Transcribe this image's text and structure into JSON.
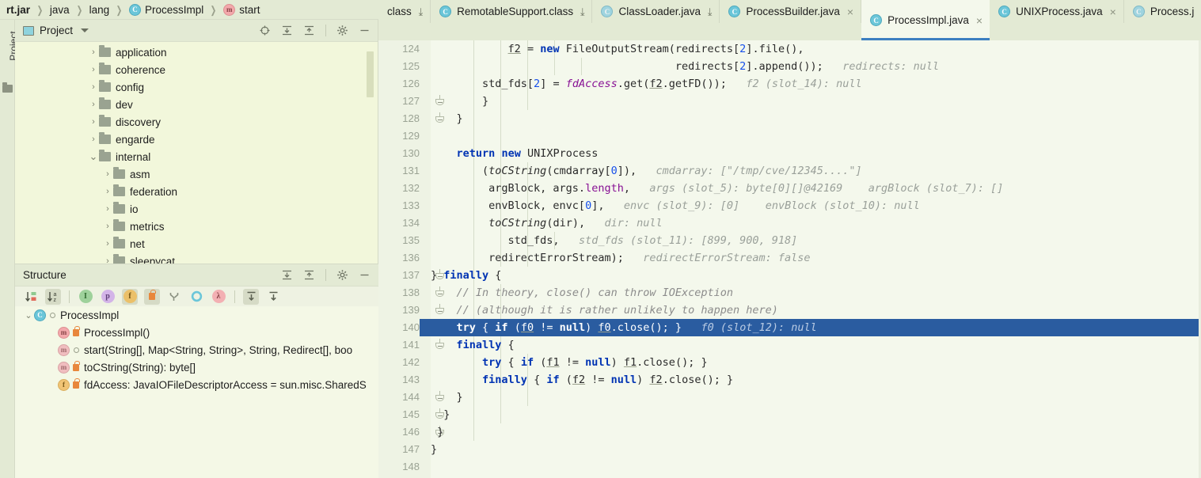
{
  "breadcrumb": {
    "name": "breadcrumb",
    "items": [
      {
        "label": "rt.jar",
        "icon": "",
        "bold": true
      },
      {
        "label": "java",
        "icon": "",
        "bold": false
      },
      {
        "label": "lang",
        "icon": "",
        "bold": false
      },
      {
        "label": "ProcessImpl",
        "icon": "class-icon",
        "bold": false
      },
      {
        "label": "start",
        "icon": "method-icon",
        "bold": false
      }
    ],
    "separator": "❯"
  },
  "tool_stripe": {
    "label": "Project",
    "icon": "project-folder-icon"
  },
  "project_panel": {
    "title": "Project",
    "dropdown_icon": "chevron-down-icon",
    "header_icons": [
      "locate-icon",
      "expand-all-icon",
      "collapse-all-icon",
      "gear-icon",
      "hide-icon"
    ],
    "tree": [
      {
        "label": "application",
        "depth": 1,
        "arrow": "›",
        "expanded": false
      },
      {
        "label": "coherence",
        "depth": 1,
        "arrow": "›",
        "expanded": false
      },
      {
        "label": "config",
        "depth": 1,
        "arrow": "›",
        "expanded": false
      },
      {
        "label": "dev",
        "depth": 1,
        "arrow": "›",
        "expanded": false
      },
      {
        "label": "discovery",
        "depth": 1,
        "arrow": "›",
        "expanded": false
      },
      {
        "label": "engarde",
        "depth": 1,
        "arrow": "›",
        "expanded": false
      },
      {
        "label": "internal",
        "depth": 1,
        "arrow": "⌄",
        "expanded": true
      },
      {
        "label": "asm",
        "depth": 2,
        "arrow": "›",
        "expanded": false
      },
      {
        "label": "federation",
        "depth": 2,
        "arrow": "›",
        "expanded": false
      },
      {
        "label": "io",
        "depth": 2,
        "arrow": "›",
        "expanded": false
      },
      {
        "label": "metrics",
        "depth": 2,
        "arrow": "›",
        "expanded": false
      },
      {
        "label": "net",
        "depth": 2,
        "arrow": "›",
        "expanded": false
      },
      {
        "label": "sleepycat",
        "depth": 2,
        "arrow": "›",
        "expanded": false
      }
    ]
  },
  "structure_panel": {
    "title": "Structure",
    "header_icons": [
      "expand-all-icon",
      "collapse-all-icon",
      "gear-icon",
      "hide-icon"
    ],
    "toolbar_icons": [
      {
        "name": "sort-by-visibility-icon",
        "glyph": "↓",
        "pressed": false
      },
      {
        "name": "sort-alphabetically-icon",
        "glyph": "↓",
        "pressed": true
      },
      {
        "name": "show-inherited-icon",
        "glyph": "I",
        "color": "#8fc98f",
        "text": "#2f6b2f"
      },
      {
        "name": "show-properties-icon",
        "glyph": "p",
        "color": "#cdaee4",
        "text": "#5f3f78"
      },
      {
        "name": "show-fields-icon",
        "glyph": "f",
        "color": "#e8bc5e",
        "text": "#6e5012",
        "pressed": true
      },
      {
        "name": "show-non-public-icon",
        "glyph": "■",
        "color": "#e8873c",
        "text": "#e8873c",
        "pressed": true
      },
      {
        "name": "group-by-type-icon",
        "glyph": "Y",
        "color": "#9aa08c",
        "text": "#6a7060"
      },
      {
        "name": "show-anonymous-icon",
        "glyph": "O",
        "color": "#6bc6d9",
        "text": "#6bc6d9"
      },
      {
        "name": "show-lambdas-icon",
        "glyph": "λ",
        "color": "#f3a8ab",
        "text": "#8a4548"
      },
      {
        "name": "autoscroll-to-source-icon",
        "glyph": "↑",
        "pressed": true
      },
      {
        "name": "autoscroll-from-source-icon",
        "glyph": "↓",
        "pressed": false
      }
    ],
    "tree": [
      {
        "label": "ProcessImpl",
        "depth": 0,
        "arrow": "⌄",
        "icon": "class-icon",
        "badge": "ring"
      },
      {
        "label": "ProcessImpl()",
        "depth": 1,
        "arrow": "",
        "icon": "method-icon",
        "badge": "lock"
      },
      {
        "label": "start(String[], Map<String, String>, String, Redirect[], boo",
        "depth": 1,
        "arrow": "",
        "icon": "method-static-icon",
        "badge": "ring"
      },
      {
        "label": "toCString(String): byte[]",
        "depth": 1,
        "arrow": "",
        "icon": "method-static-icon",
        "badge": "lock"
      },
      {
        "label": "fdAccess: JavaIOFileDescriptorAccess = sun.misc.SharedS",
        "depth": 1,
        "arrow": "",
        "icon": "field-static-icon",
        "badge": "lock"
      }
    ]
  },
  "editor": {
    "tabs": [
      {
        "label": "class",
        "icon": "",
        "active": false,
        "close": "pin",
        "truncated_left": true
      },
      {
        "label": "RemotableSupport.class",
        "icon": "class-icon",
        "active": false,
        "close": "pin"
      },
      {
        "label": "ClassLoader.java",
        "icon": "class-dim-icon",
        "active": false,
        "close": "pin"
      },
      {
        "label": "ProcessBuilder.java",
        "icon": "class-icon",
        "active": false,
        "close": "x"
      },
      {
        "label": "ProcessImpl.java",
        "icon": "class-icon",
        "active": true,
        "close": "x"
      },
      {
        "label": "UNIXProcess.java",
        "icon": "class-icon",
        "active": false,
        "close": "x"
      },
      {
        "label": "Process.j",
        "icon": "class-dim-icon",
        "active": false,
        "close": ""
      }
    ],
    "first_line_number": 124,
    "selected_line": 140,
    "lines": [
      {
        "n": 124,
        "indent": 0,
        "fold": "",
        "html": "partial-top"
      },
      {
        "n": 125,
        "indent": 0,
        "fold": "",
        "html": "l125"
      },
      {
        "n": 126,
        "indent": 0,
        "fold": "",
        "html": "l126"
      },
      {
        "n": 127,
        "indent": 0,
        "fold": "minus",
        "html": "l127"
      },
      {
        "n": 128,
        "indent": 0,
        "fold": "minus",
        "html": "l128"
      },
      {
        "n": 129,
        "indent": 0,
        "fold": "",
        "html": ""
      },
      {
        "n": 130,
        "indent": 0,
        "fold": "",
        "html": "l130"
      },
      {
        "n": 131,
        "indent": 0,
        "fold": "",
        "html": "l131"
      },
      {
        "n": 132,
        "indent": 0,
        "fold": "",
        "html": "l132"
      },
      {
        "n": 133,
        "indent": 0,
        "fold": "",
        "html": "l133"
      },
      {
        "n": 134,
        "indent": 0,
        "fold": "",
        "html": "l134"
      },
      {
        "n": 135,
        "indent": 0,
        "fold": "",
        "html": "l135"
      },
      {
        "n": 136,
        "indent": 0,
        "fold": "",
        "html": "l136"
      },
      {
        "n": 137,
        "indent": 0,
        "fold": "minus",
        "html": "l137"
      },
      {
        "n": 138,
        "indent": 0,
        "fold": "minus",
        "html": "l138"
      },
      {
        "n": 139,
        "indent": 0,
        "fold": "minus",
        "html": "l139"
      },
      {
        "n": 140,
        "indent": 0,
        "fold": "",
        "html": "l140"
      },
      {
        "n": 141,
        "indent": 0,
        "fold": "minus",
        "html": "l141"
      },
      {
        "n": 142,
        "indent": 0,
        "fold": "",
        "html": "l142"
      },
      {
        "n": 143,
        "indent": 0,
        "fold": "",
        "html": "l143"
      },
      {
        "n": 144,
        "indent": 0,
        "fold": "minus",
        "html": "l144"
      },
      {
        "n": 145,
        "indent": 0,
        "fold": "minus",
        "html": "l145"
      },
      {
        "n": 146,
        "indent": 0,
        "fold": "minus",
        "html": "l146"
      },
      {
        "n": 147,
        "indent": 0,
        "fold": "",
        "html": "l147"
      },
      {
        "n": 148,
        "indent": 0,
        "fold": "",
        "html": ""
      }
    ],
    "code_text": {
      "l124": "            f2 = new FileOutputStream(redirects[2].file(),",
      "l125": "                                      redirects[2].append());   redirects: null",
      "l126": "        std_fds[2] = fdAccess.get(f2.getFD());   f2 (slot_14): null",
      "l127": "        }",
      "l128": "    }",
      "l130": "    return new UNIXProcess",
      "l131": "        (toCString(cmdarray[0]),   cmdarray: [\"/tmp/cve/12345....\"]",
      "l132": "         argBlock, args.length,   args (slot_5): byte[0][]@42169    argBlock (slot_7): []",
      "l133": "         envBlock, envc[0],   envc (slot_9): [0]    envBlock (slot_10): null",
      "l134": "         toCString(dir),   dir: null",
      "l135": "            std_fds,   std_fds (slot_11): [899, 900, 918]",
      "l136": "         redirectErrorStream);   redirectErrorStream: false",
      "l137": "} finally {",
      "l138": "    // In theory, close() can throw IOException",
      "l139": "    // (although it is rather unlikely to happen here)",
      "l140": "    try { if (f0 != null) f0.close(); }   f0 (slot_12): null",
      "l141": "    finally {",
      "l142": "        try { if (f1 != null) f1.close(); }",
      "l143": "        finally { if (f2 != null) f2.close(); }",
      "l144": "    }",
      "l145": "  }",
      "l146": " }",
      "l147": "}"
    },
    "inline_hints": {
      "redirects": "redirects: null",
      "f2_slot14": "f2 (slot_14): null",
      "cmdarray": "cmdarray: [\"/tmp/cve/12345....\"]",
      "args_slot5": "args (slot_5): byte[0][]@42169",
      "argBlock_slot7": "argBlock (slot_7): []",
      "envc_slot9": "envc (slot_9): [0]",
      "envBlock_slot10": "envBlock (slot_10): null",
      "dir": "dir: null",
      "std_fds_slot11": "std_fds (slot_11): [899, 900, 918]",
      "redirectErrorStream": "redirectErrorStream: false",
      "f0_slot12": "f0 (slot_12): null"
    }
  },
  "colors": {
    "panel_bg": "#e3ead4",
    "tree_bg": "#f2f7db",
    "editor_bg": "#f4f8ec",
    "gutter_bg": "#eef3e4",
    "selection": "#2a5ca0",
    "active_tab_underline": "#3d7fc1",
    "keyword": "#0033b3",
    "number": "#1750eb",
    "field": "#871094",
    "comment": "#8c8c8c",
    "hint": "#9aa09a"
  }
}
